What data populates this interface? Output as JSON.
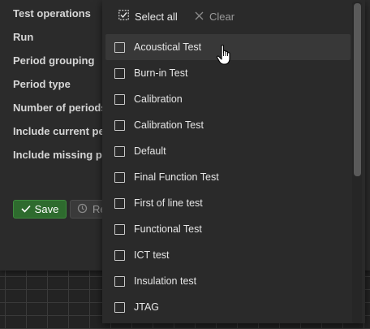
{
  "settings": {
    "labels": [
      "Test operations",
      "Run",
      "Period grouping",
      "Period type",
      "Number of periods",
      "Include current period",
      "Include missing periods"
    ],
    "save_label": "Save",
    "reset_label": "Reset"
  },
  "dropdown": {
    "select_all_label": "Select all",
    "clear_label": "Clear",
    "options": [
      "Acoustical Test",
      "Burn-in Test",
      "Calibration",
      "Calibration Test",
      "Default",
      "Final Function Test",
      "First of line test",
      "Functional Test",
      "ICT test",
      "Insulation test",
      "JTAG"
    ],
    "hovered_option": "Acoustical Test"
  },
  "colors": {
    "panel_bg": "#2b2b2b",
    "popup_bg": "#2a2a2a",
    "save_green": "#2e6b2e",
    "text": "#e6e6e6"
  }
}
